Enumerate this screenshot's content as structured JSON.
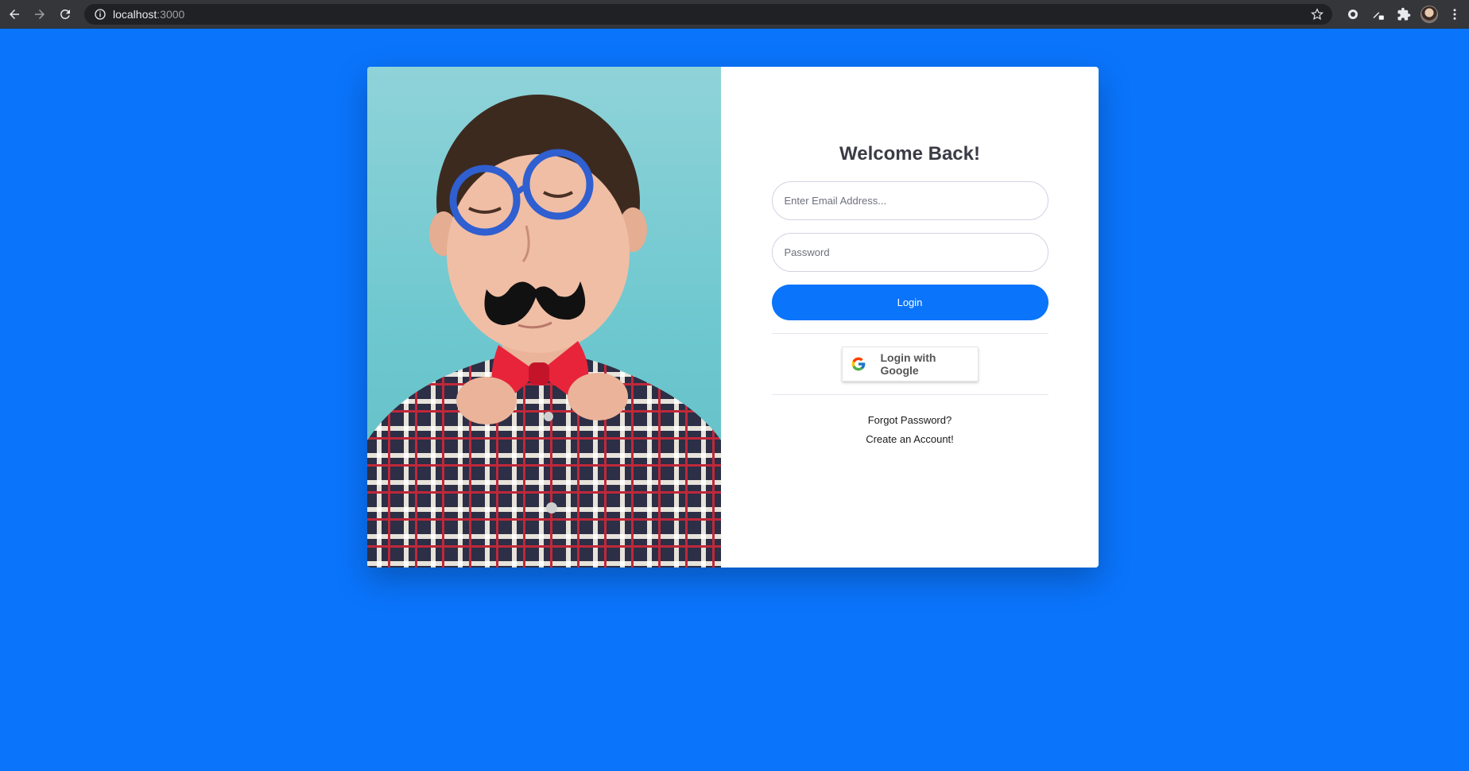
{
  "browser": {
    "url_host": "localhost",
    "url_port": ":3000"
  },
  "login": {
    "title": "Welcome Back!",
    "email_placeholder": "Enter Email Address...",
    "password_placeholder": "Password",
    "login_button": "Login",
    "google_button": "Login with Google",
    "forgot_password": "Forgot Password?",
    "create_account": "Create an Account!"
  },
  "colors": {
    "background": "#0a74fb",
    "primary_button": "#0a74fb",
    "title_text": "#3a3b45"
  },
  "icons": [
    "back-arrow-icon",
    "forward-arrow-icon",
    "reload-icon",
    "info-icon",
    "star-icon",
    "extension-icon",
    "puzzle-icon",
    "google-icon"
  ]
}
